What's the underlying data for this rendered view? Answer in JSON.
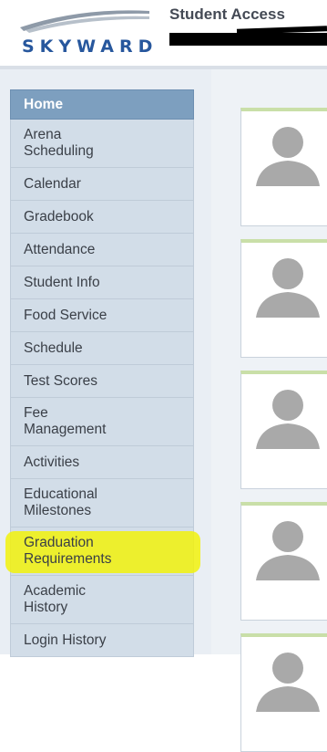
{
  "header": {
    "logo_text": "SKYWARD",
    "title": "Student Access"
  },
  "sidebar": {
    "items": [
      {
        "label": "Home",
        "lines": [
          "Home"
        ],
        "selected": true
      },
      {
        "label": "Arena Scheduling",
        "lines": [
          "Arena",
          "Scheduling"
        ]
      },
      {
        "label": "Calendar",
        "lines": [
          "Calendar"
        ]
      },
      {
        "label": "Gradebook",
        "lines": [
          "Gradebook"
        ]
      },
      {
        "label": "Attendance",
        "lines": [
          "Attendance"
        ]
      },
      {
        "label": "Student Info",
        "lines": [
          "Student Info"
        ]
      },
      {
        "label": "Food Service",
        "lines": [
          "Food Service"
        ]
      },
      {
        "label": "Schedule",
        "lines": [
          "Schedule"
        ]
      },
      {
        "label": "Test Scores",
        "lines": [
          "Test Scores"
        ]
      },
      {
        "label": "Fee Management",
        "lines": [
          "Fee",
          "Management"
        ]
      },
      {
        "label": "Activities",
        "lines": [
          "Activities"
        ]
      },
      {
        "label": "Educational Milestones",
        "lines": [
          "Educational",
          "Milestones"
        ]
      },
      {
        "label": "Graduation Requirements",
        "lines": [
          "Graduation",
          "Requirements"
        ],
        "highlighted": true
      },
      {
        "label": "Academic History",
        "lines": [
          "Academic",
          "History"
        ]
      },
      {
        "label": "Login History",
        "lines": [
          "Login History"
        ]
      }
    ]
  },
  "colors": {
    "logo_blue": "#27579d",
    "home_bg": "#7d9fbf",
    "nav_bg": "#d2dde8",
    "highlight": "#f2f20c",
    "card_top_border": "#c9dfa8"
  },
  "icons": {
    "avatar": "person-silhouette-icon"
  }
}
